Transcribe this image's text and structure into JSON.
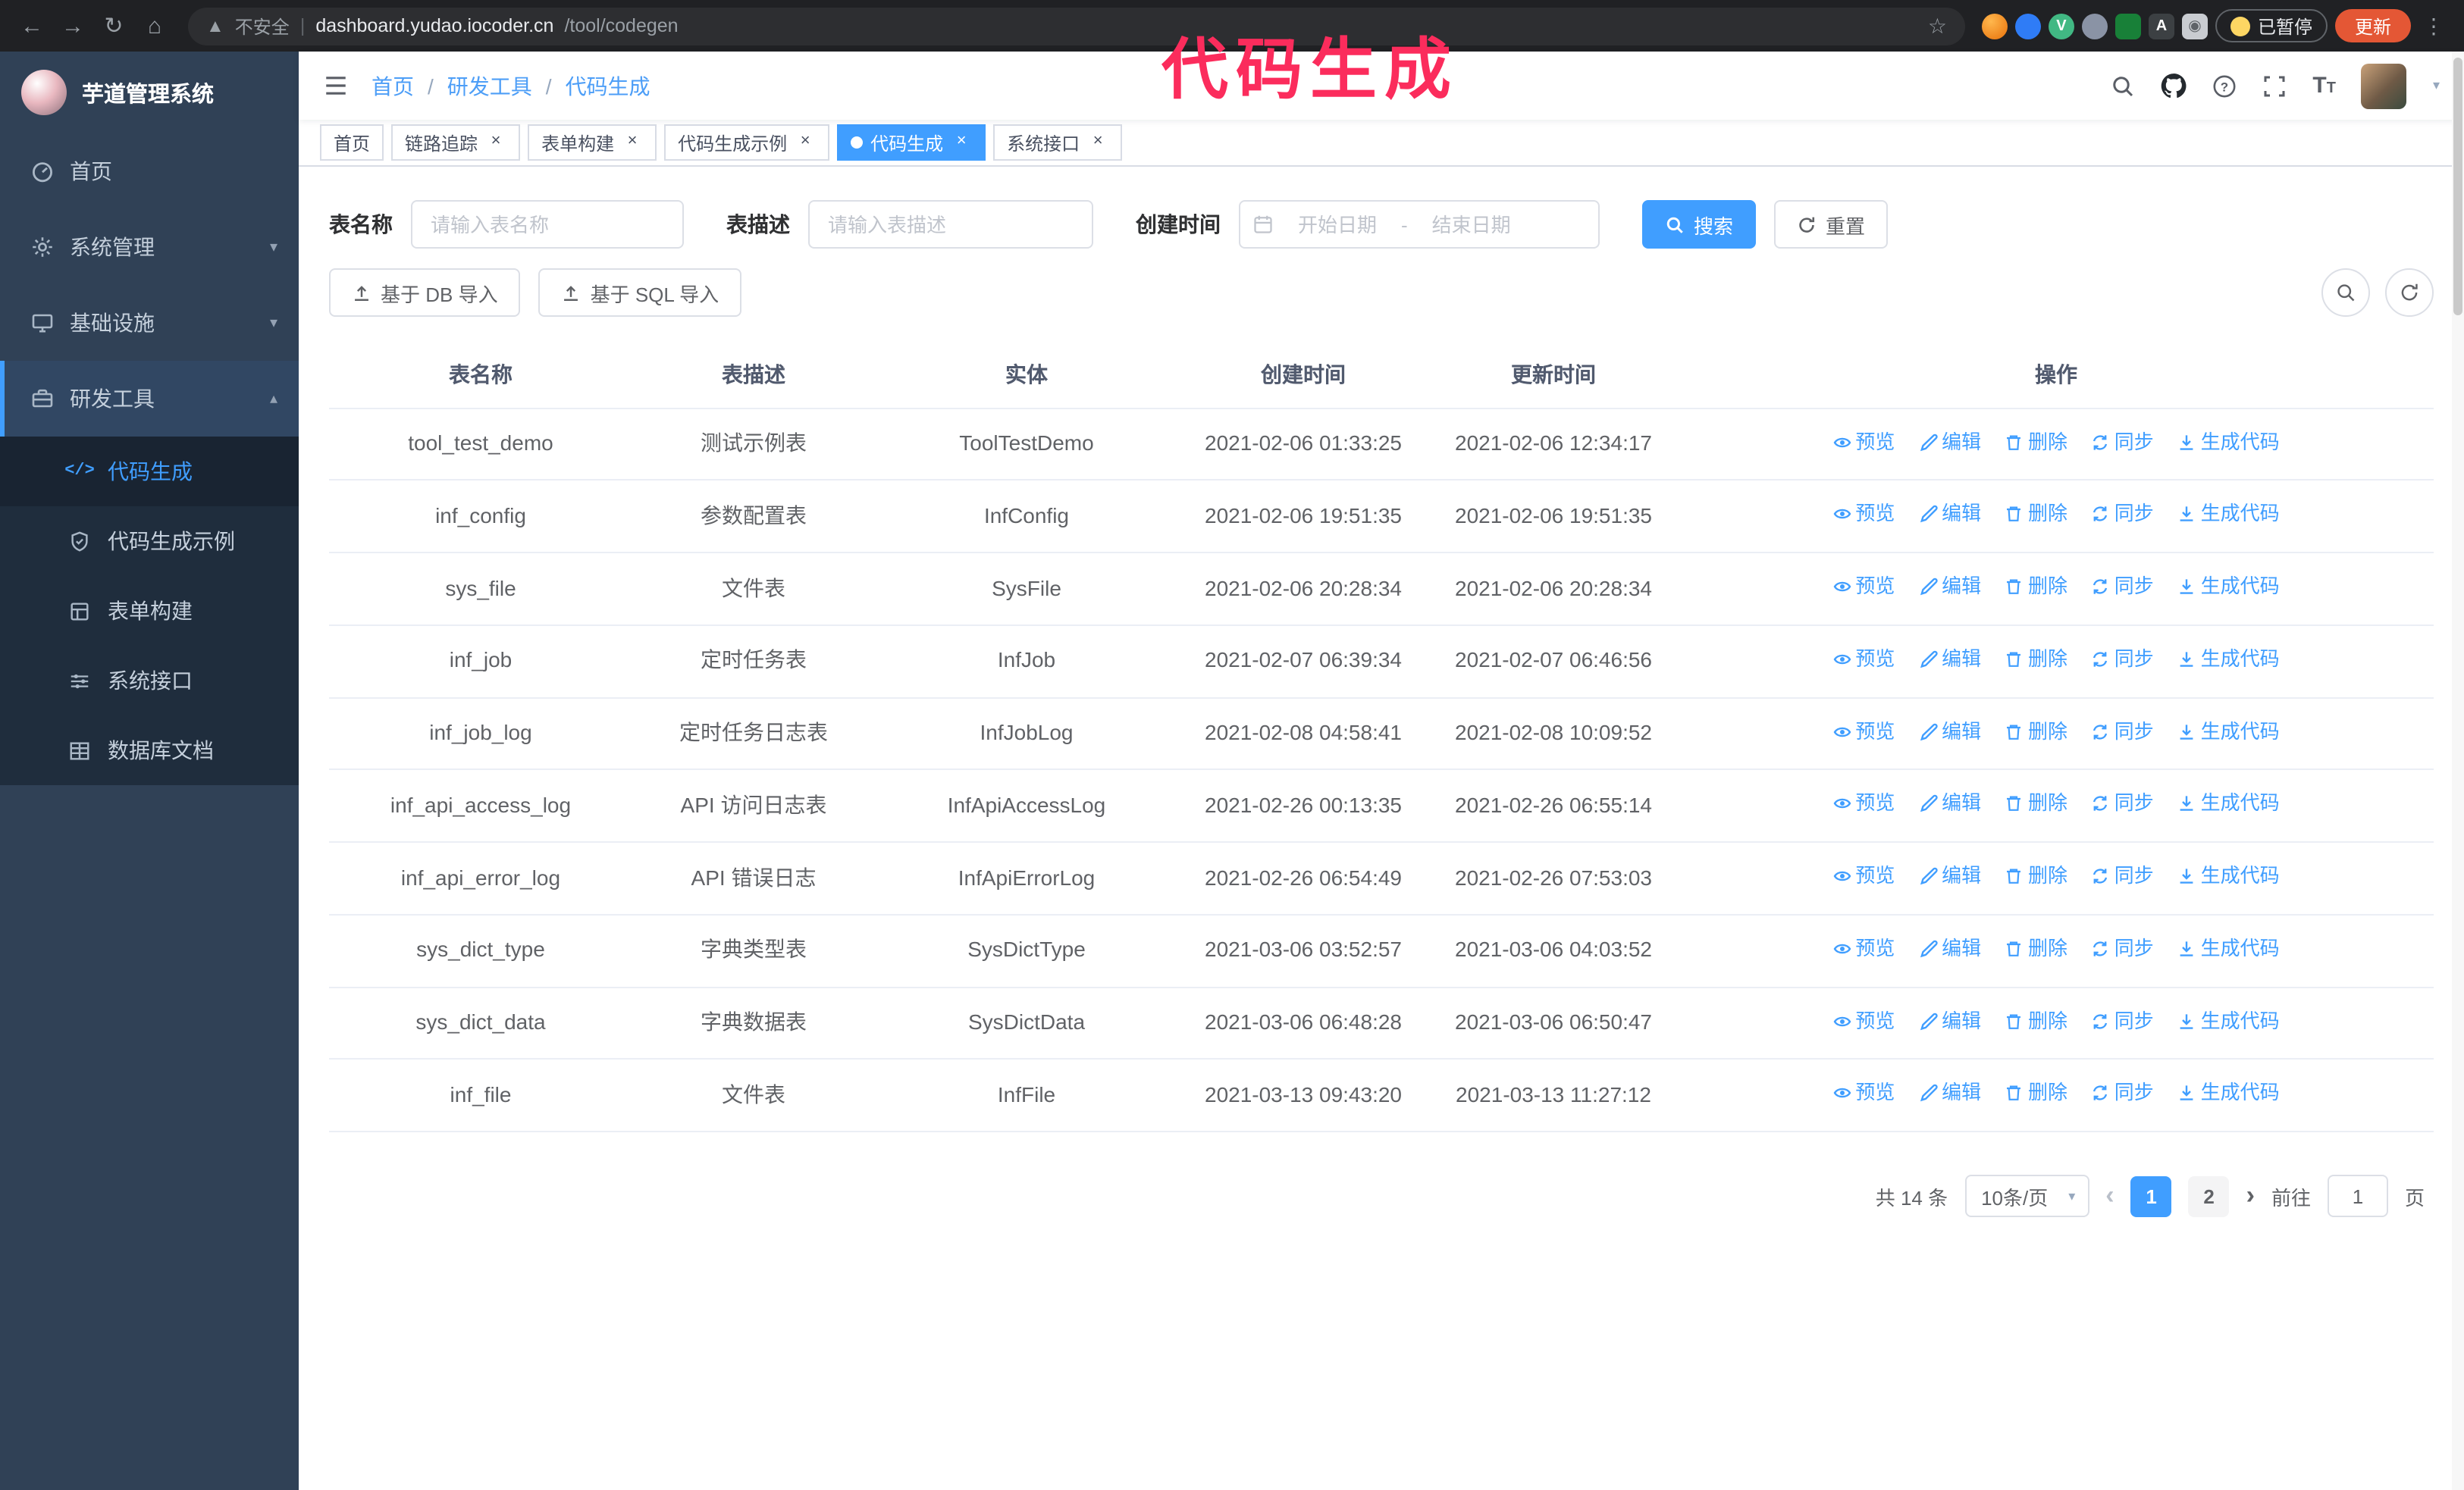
{
  "colors": {
    "primary": "#409eff",
    "sidebar_bg": "#304156",
    "submenu_bg": "#1f2d3d",
    "active_tab": "#409eff",
    "annotation": "#fb2c5c",
    "update_button": "#e45735"
  },
  "annotation": {
    "text": "代码生成"
  },
  "browser": {
    "security_warning": "不安全",
    "url_host": "dashboard.yudao.iocoder.cn",
    "url_path": "/tool/codegen",
    "paused_badge": "已暂停",
    "update_button": "更新"
  },
  "sidebar": {
    "logo_title": "芋道管理系统",
    "items": [
      {
        "label": "首页"
      },
      {
        "label": "系统管理"
      },
      {
        "label": "基础设施"
      },
      {
        "label": "研发工具"
      }
    ],
    "dev_tools_children": [
      {
        "label": "代码生成"
      },
      {
        "label": "代码生成示例"
      },
      {
        "label": "表单构建"
      },
      {
        "label": "系统接口"
      },
      {
        "label": "数据库文档"
      }
    ]
  },
  "header": {
    "breadcrumb": [
      "首页",
      "研发工具",
      "代码生成"
    ]
  },
  "tabs": [
    {
      "label": "首页"
    },
    {
      "label": "链路追踪"
    },
    {
      "label": "表单构建"
    },
    {
      "label": "代码生成示例"
    },
    {
      "label": "代码生成"
    },
    {
      "label": "系统接口"
    }
  ],
  "filters": {
    "name_label": "表名称",
    "name_placeholder": "请输入表名称",
    "desc_label": "表描述",
    "desc_placeholder": "请输入表描述",
    "time_label": "创建时间",
    "start_placeholder": "开始日期",
    "range_separator": "-",
    "end_placeholder": "结束日期",
    "search_button": "搜索",
    "reset_button": "重置"
  },
  "toolbar": {
    "import_db": "基于 DB 导入",
    "import_sql": "基于 SQL 导入"
  },
  "table": {
    "columns": [
      "表名称",
      "表描述",
      "实体",
      "创建时间",
      "更新时间",
      "操作"
    ],
    "row_actions": [
      "预览",
      "编辑",
      "删除",
      "同步",
      "生成代码"
    ],
    "rows": [
      {
        "name": "tool_test_demo",
        "desc": "测试示例表",
        "entity": "ToolTestDemo",
        "created": "2021-02-06 01:33:25",
        "updated": "2021-02-06 12:34:17"
      },
      {
        "name": "inf_config",
        "desc": "参数配置表",
        "entity": "InfConfig",
        "created": "2021-02-06 19:51:35",
        "updated": "2021-02-06 19:51:35"
      },
      {
        "name": "sys_file",
        "desc": "文件表",
        "entity": "SysFile",
        "created": "2021-02-06 20:28:34",
        "updated": "2021-02-06 20:28:34"
      },
      {
        "name": "inf_job",
        "desc": "定时任务表",
        "entity": "InfJob",
        "created": "2021-02-07 06:39:34",
        "updated": "2021-02-07 06:46:56"
      },
      {
        "name": "inf_job_log",
        "desc": "定时任务日志表",
        "entity": "InfJobLog",
        "created": "2021-02-08 04:58:41",
        "updated": "2021-02-08 10:09:52"
      },
      {
        "name": "inf_api_access_log",
        "desc": "API 访问日志表",
        "entity": "InfApiAccessLog",
        "created": "2021-02-26 00:13:35",
        "updated": "2021-02-26 06:55:14"
      },
      {
        "name": "inf_api_error_log",
        "desc": "API 错误日志",
        "entity": "InfApiErrorLog",
        "created": "2021-02-26 06:54:49",
        "updated": "2021-02-26 07:53:03"
      },
      {
        "name": "sys_dict_type",
        "desc": "字典类型表",
        "entity": "SysDictType",
        "created": "2021-03-06 03:52:57",
        "updated": "2021-03-06 04:03:52"
      },
      {
        "name": "sys_dict_data",
        "desc": "字典数据表",
        "entity": "SysDictData",
        "created": "2021-03-06 06:48:28",
        "updated": "2021-03-06 06:50:47"
      },
      {
        "name": "inf_file",
        "desc": "文件表",
        "entity": "InfFile",
        "created": "2021-03-13 09:43:20",
        "updated": "2021-03-13 11:27:12"
      }
    ]
  },
  "pagination": {
    "total_text": "共 14 条",
    "page_size": "10条/页",
    "pages": [
      "1",
      "2"
    ],
    "current_page": "1",
    "goto_label": "前往",
    "goto_value": "1",
    "page_suffix": "页"
  }
}
